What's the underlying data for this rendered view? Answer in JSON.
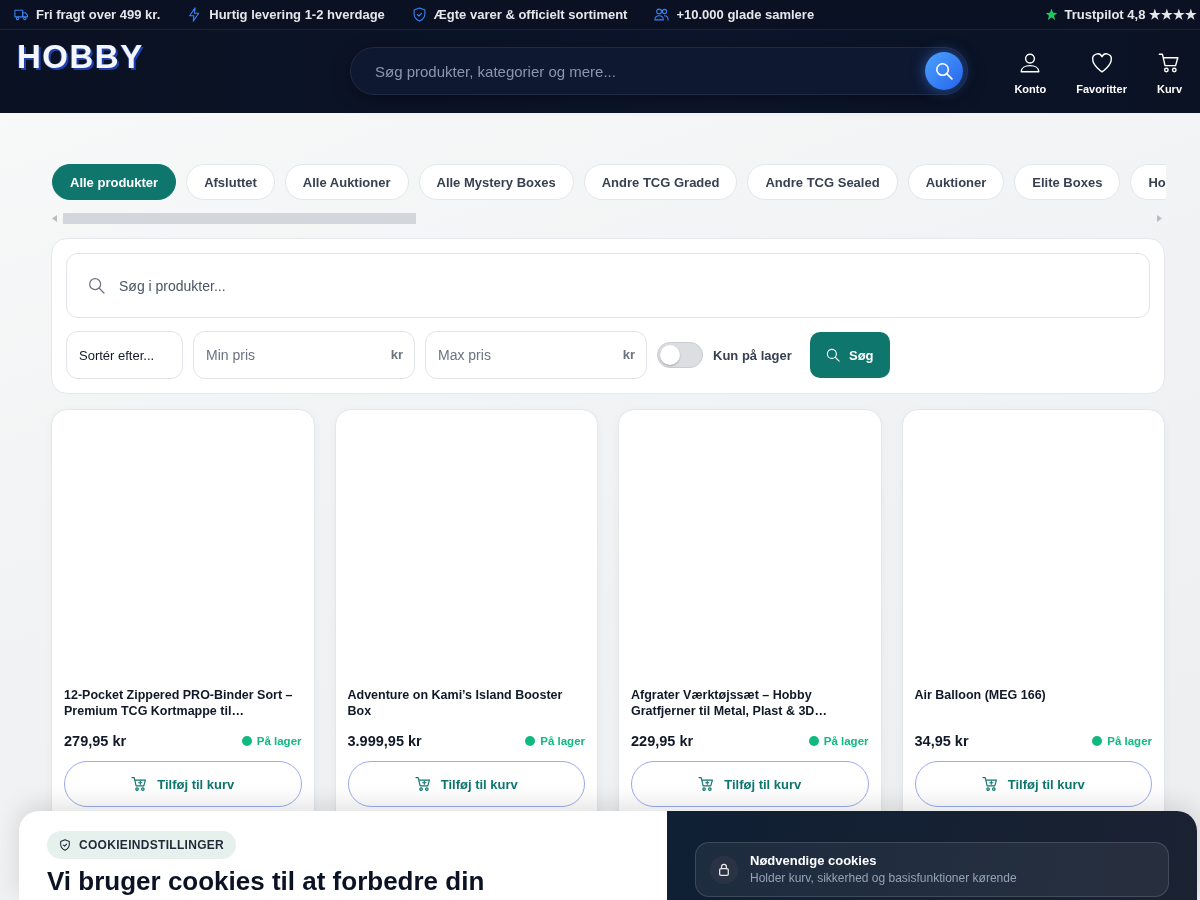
{
  "announcement_bar": {
    "items": [
      {
        "kind": "truck",
        "text": "Fri fragt over 499 kr."
      },
      {
        "kind": "bolt",
        "text": "Hurtig levering 1-2 hverdage"
      },
      {
        "kind": "shield",
        "text": "Ægte varer & officielt sortiment"
      },
      {
        "kind": "people",
        "text": "+10.000 glade samlere"
      }
    ],
    "rating": "Trustpilot 4,8 ★★★★"
  },
  "header": {
    "logo": "HOBBY",
    "search": {
      "placeholder": "Søg produkter, kategorier og mere..."
    },
    "actions": [
      {
        "kind": "account",
        "label": "Konto"
      },
      {
        "kind": "favorites",
        "label": "Favoritter"
      },
      {
        "kind": "cart",
        "label": "Kurv"
      }
    ]
  },
  "categories": [
    {
      "label": "Alle produkter",
      "selected": true
    },
    {
      "label": "Afsluttet",
      "selected": false
    },
    {
      "label": "Alle Auktioner",
      "selected": false
    },
    {
      "label": "Alle Mystery Boxes",
      "selected": false
    },
    {
      "label": "Andre TCG Graded",
      "selected": false
    },
    {
      "label": "Andre TCG Sealed",
      "selected": false
    },
    {
      "label": "Auktioner",
      "selected": false
    },
    {
      "label": "Elite Boxes",
      "selected": false
    },
    {
      "label": "Ho",
      "selected": false
    }
  ],
  "filters": {
    "search": {
      "placeholder": "Søg i produkter..."
    },
    "sort": {
      "value": "Sortér efter..."
    },
    "min_price": {
      "placeholder": "Min pris",
      "unit": "kr"
    },
    "max_price": {
      "placeholder": "Max pris",
      "unit": "kr"
    },
    "in_stock": {
      "label": "Kun på lager",
      "on": false
    },
    "submit": "Søg"
  },
  "products": [
    {
      "title": "12-Pocket Zippered PRO-Binder Sort – Premium TCG Kortmappe til…",
      "price": "279,95 kr",
      "stock": "På lager",
      "in_stock": true,
      "button": "Tilføj til kurv"
    },
    {
      "title": "Adventure on Kami’s Island Booster Box",
      "price": "3.999,95 kr",
      "stock": "På lager",
      "in_stock": true,
      "button": "Tilføj til kurv"
    },
    {
      "title": "Afgrater Værktøjssæt – Hobby Gratfjerner til Metal, Plast & 3D…",
      "price": "229,95 kr",
      "stock": "På lager",
      "in_stock": true,
      "button": "Tilføj til kurv"
    },
    {
      "title": "Air Balloon (MEG 166)",
      "price": "34,95 kr",
      "stock": "På lager",
      "in_stock": true,
      "button": "Tilføj til kurv"
    }
  ],
  "cookie_banner": {
    "badge": "COOKIEINDSTILLINGER",
    "heading": "Vi bruger cookies til at forbedre din",
    "categories": [
      {
        "kind": "lock",
        "title": "Nødvendige cookies",
        "description": "Holder kurv, sikkerhed og basisfunktioner kørende"
      }
    ]
  }
}
